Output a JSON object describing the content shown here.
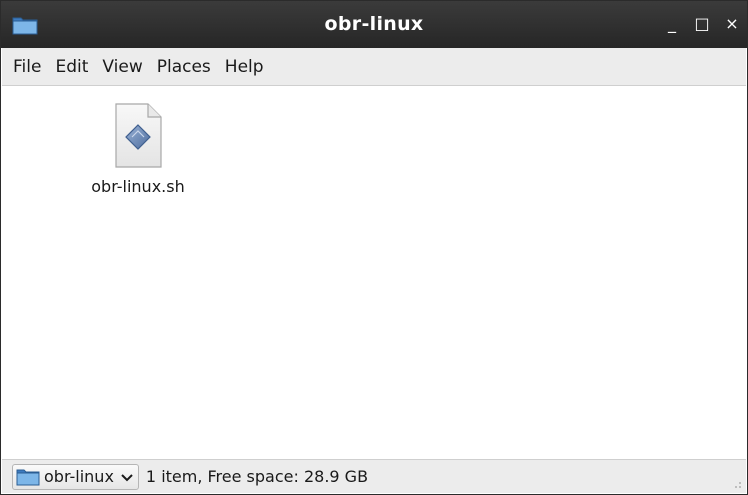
{
  "window": {
    "title": "obr-linux",
    "minimize_glyph": "_",
    "maximize_glyph": "□",
    "close_glyph": "×",
    "app_icon": "folder-icon"
  },
  "menubar": {
    "items": [
      "File",
      "Edit",
      "View",
      "Places",
      "Help"
    ]
  },
  "content": {
    "files": [
      {
        "name": "obr-linux.sh",
        "icon": "script-file-icon"
      }
    ]
  },
  "statusbar": {
    "location": "obr-linux",
    "status": "1 item, Free space: 28.9 GB"
  },
  "colors": {
    "titlebar": "#2f2f2f",
    "menubar": "#ececec",
    "folder": "#5f9fd6"
  }
}
